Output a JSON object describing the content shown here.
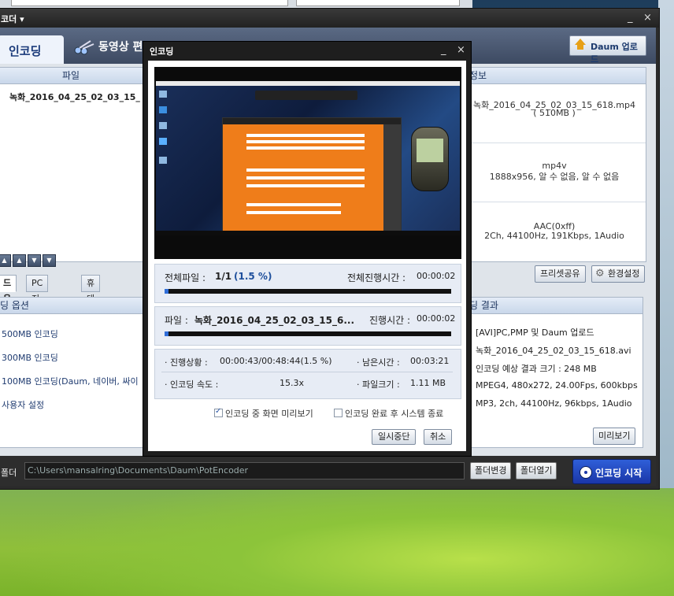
{
  "main_window": {
    "title": "코더 ▾",
    "minimize": "_",
    "close": "×",
    "tabs": [
      {
        "label": "인코딩"
      },
      {
        "label": "동영상 편"
      }
    ],
    "upload_button": "Daum 업로드",
    "file_panel": {
      "header": "파일",
      "rows": [
        "녹화_2016_04_25_02_03_15_"
      ]
    },
    "arrow_buttons": [
      "▲",
      "▲",
      "▼",
      "▼"
    ],
    "info_panel": {
      "header": "정보",
      "cells": [
        {
          "line1": "녹화_2016_04_25_02_03_15_618.mp4",
          "line2": "( 510MB )"
        },
        {
          "line1": "mp4v",
          "line2": "1888x956, 알 수 없음, 알 수 없음"
        },
        {
          "line1": "AAC(0xff)",
          "line2": "2Ch, 44100Hz, 191Kbps, 1Audio"
        }
      ]
    },
    "subtabs": [
      "드용",
      "PC 저장용",
      "휴대 기기용"
    ],
    "preset_share": "프리셋공유",
    "env_settings": "환경설정",
    "options_panel": {
      "header": "딩 옵션",
      "items": [
        "500MB 인코딩",
        "300MB 인코딩",
        "100MB 인코딩(Daum, 네이버, 싸이",
        "사용자 설정"
      ]
    },
    "result_panel": {
      "header": "딩 결과",
      "items": [
        "[AVI]PC,PMP 및 Daum 업로드",
        "녹화_2016_04_25_02_03_15_618.avi",
        "인코딩 예상 결과 크기 : 248 MB",
        "MPEG4, 480x272, 24.00Fps, 600kbps",
        "MP3, 2ch, 44100Hz, 96kbps, 1Audio"
      ]
    },
    "preview_button": "미리보기",
    "folder": {
      "label": "폴더",
      "path": "C:\\Users\\mansalring\\Documents\\Daum\\PotEncoder",
      "change_button": "폴더변경",
      "open_button": "폴더열기"
    },
    "start_button": "인코딩 시작"
  },
  "dialog": {
    "title": "인코딩",
    "minimize": "_",
    "close": "×",
    "total_files_label": "전체파일 :",
    "total_files_value": "1/1",
    "total_percent": "(1.5 %)",
    "total_elapsed_label": "전체진행시간 :",
    "total_elapsed_value": "00:00:02",
    "total_progress": 0.015,
    "file_label": "파일 :",
    "file_name": "녹화_2016_04_25_02_03_15_6...",
    "elapsed_label": "진행시간 :",
    "elapsed_value": "00:00:02",
    "file_progress": 0.015,
    "progress_label": "· 진행상황 :",
    "progress_value": "00:00:43/00:48:44(1.5 %)",
    "remaining_label": "· 남은시간 :",
    "remaining_value": "00:03:21",
    "speed_label": "· 인코딩 속도 :",
    "speed_value": "15.3x",
    "filesize_label": "· 파일크기 :",
    "filesize_value": "1.11 MB",
    "preview_checkbox": "인코딩 중 화면 미리보기",
    "shutdown_checkbox": "인코딩 완료 후 시스템 종료",
    "preview_checked": true,
    "shutdown_checked": false,
    "pause_button": "일시중단",
    "cancel_button": "취소"
  }
}
